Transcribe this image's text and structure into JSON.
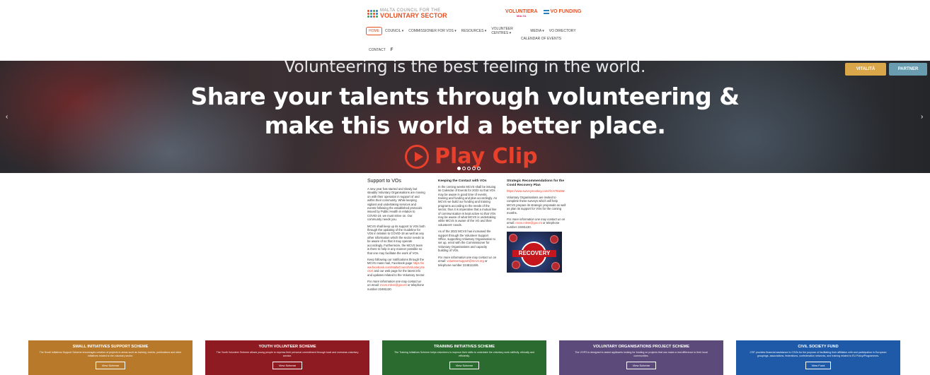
{
  "header": {
    "logo_mcvs_line1": "MALTA COUNCIL FOR THE",
    "logo_mcvs_line2": "VOLUNTARY SECTOR",
    "logo_volunteer": "VOLUNTIERA",
    "logo_volunteer_sub": "MALTA",
    "logo_vofunding": "VO FUNDING",
    "nav_row1": [
      "HOME",
      "COUNCIL ▾",
      "COMMISSIONER FOR VOS ▾",
      "RESOURCES ▾",
      "VOLUNTEER CENTRES ▾",
      "MEDIA ▾",
      "VO DIRECTORY"
    ],
    "nav_calendar": "CALENDAR OF EVENTS",
    "nav_contact": "CONTACT",
    "nav_facebook": "f"
  },
  "hero": {
    "subtitle": "Volunteering is the best feeling in the world.",
    "title_line1": "Share your talents through volunteering &",
    "title_line2": "make this world a better place.",
    "play_label": "Play Clip",
    "prev_arrow": "‹",
    "next_arrow": "›",
    "slide_count": 5,
    "active_slide": 1,
    "corner_logo1": "VITALITÀ",
    "corner_logo2": "PARTNER"
  },
  "support": {
    "title": "Support to VOs",
    "p1": "A new year has started and slowly but steadily Voluntary Organisations are moving on with their operation in support of and within their community. While keeping vigilant and undertaking services and events following the established protocols issued by Public Health in relation to COVID-19, we must strive on. Our community needs you.",
    "p2": "MCVS shall keep up its support to VOs both through the updating of the Guideline for VOs in relation to COVID-19 as well as any other information which the sector needs to be aware of so that it may operate accordingly. Furthermore, the MCVS team is there to help in any manner possible so that one may facilitate the work of VOs.",
    "p3_start": "Keep following our notifications through the MCVS mass mail, Facebook page",
    "p3_link": "https://www.facebook.com/MaltaCouncilVoluntarySector/",
    "p3_end": "and our web page for the latest info and updates related to the Voluntary Sector.",
    "p4_start": "For more information one may contact us on email:",
    "p4_email": "mcvs.mlsm@gov.mt",
    "p4_end": "or telephone number 22481130."
  },
  "contact": {
    "title": "Keeping the Contact with VOs",
    "p1": "In the coming weeks MCVS shall be issuing its Calendar of Events for 2022 so that VOs may be aware in good time of events, training and funding and plan accordingly. As MCVS we build our funding and training programs according to the needs of the sector, thus it is imperative that a mutual line of communication is kept active so that VOs may be aware of what MCVS is undertaking while MCVS is aware of the VO and their volunteers' needs.",
    "p2": "As of the 2022 MCVS has increased the support through the Volunteer Support Office, supporting Voluntary Organisation to set up, enrol with the Commissioner for Voluntary Organisations and capacity building of VOs.",
    "p3_start": "For more information one may contact us on email:",
    "p3_email": "volunteersupport@mcvs.org",
    "p3_end": "or telephone number 22481115/6."
  },
  "strategic": {
    "title": "Strategic Recommendations for the Covid Recovery Plan",
    "link": "https://www.surveymonkey.com/r/CX7B15W",
    "p1": "Voluntary Organisations are invited to complete these surveys which will help MCVS prepare its strategic proposals as well as plan its support for VOs for the coming months.",
    "p2_start": "For more information one may contact us on email:",
    "p2_email": "mcvs.mlsm@gov.mt",
    "p2_end": "or telephone number 22481130.",
    "image_label": "RECOVERY"
  },
  "schemes": [
    {
      "title": "SMALL INITIATIVES SUPPORT SCHEME",
      "desc": "The Small Initiatives Support Scheme encourages creation of projects in areas such as training, events, publications and other initiatives related to the voluntary sector.",
      "button": "View Scheme",
      "color": "#b8792a"
    },
    {
      "title": "YOUTH VOLUNTEER SCHEME",
      "desc": "The Youth Volunteer Scheme allows young people to express their personal commitment through local and overseas voluntary service.",
      "button": "View Scheme",
      "color": "#8e1b21"
    },
    {
      "title": "TRAINING INITIATIVES SCHEME",
      "desc": "The Training Initiatives Scheme helps volunteers to improve their skills to undertake the voluntary work skillfully, ethically and efficiently.",
      "button": "View Scheme",
      "color": "#2c6b2f"
    },
    {
      "title": "VOLUNTARY ORGANISATIONS PROJECT SCHEME",
      "desc": "The VOPS is designed to assist applicants looking for funding on projects that can make a real difference to their local communities.",
      "button": "View Scheme",
      "color": "#5b4a7a"
    },
    {
      "title": "CIVIL SOCIETY FUND",
      "desc": "CSF provides financial assistance to CSOs for the purpose of facilitating their affiliation with and participation in European groupings, associations, federations, confederation networks, and training related to EU Policy/Programmes.",
      "button": "View Fund",
      "color": "#1e5aa8"
    }
  ]
}
